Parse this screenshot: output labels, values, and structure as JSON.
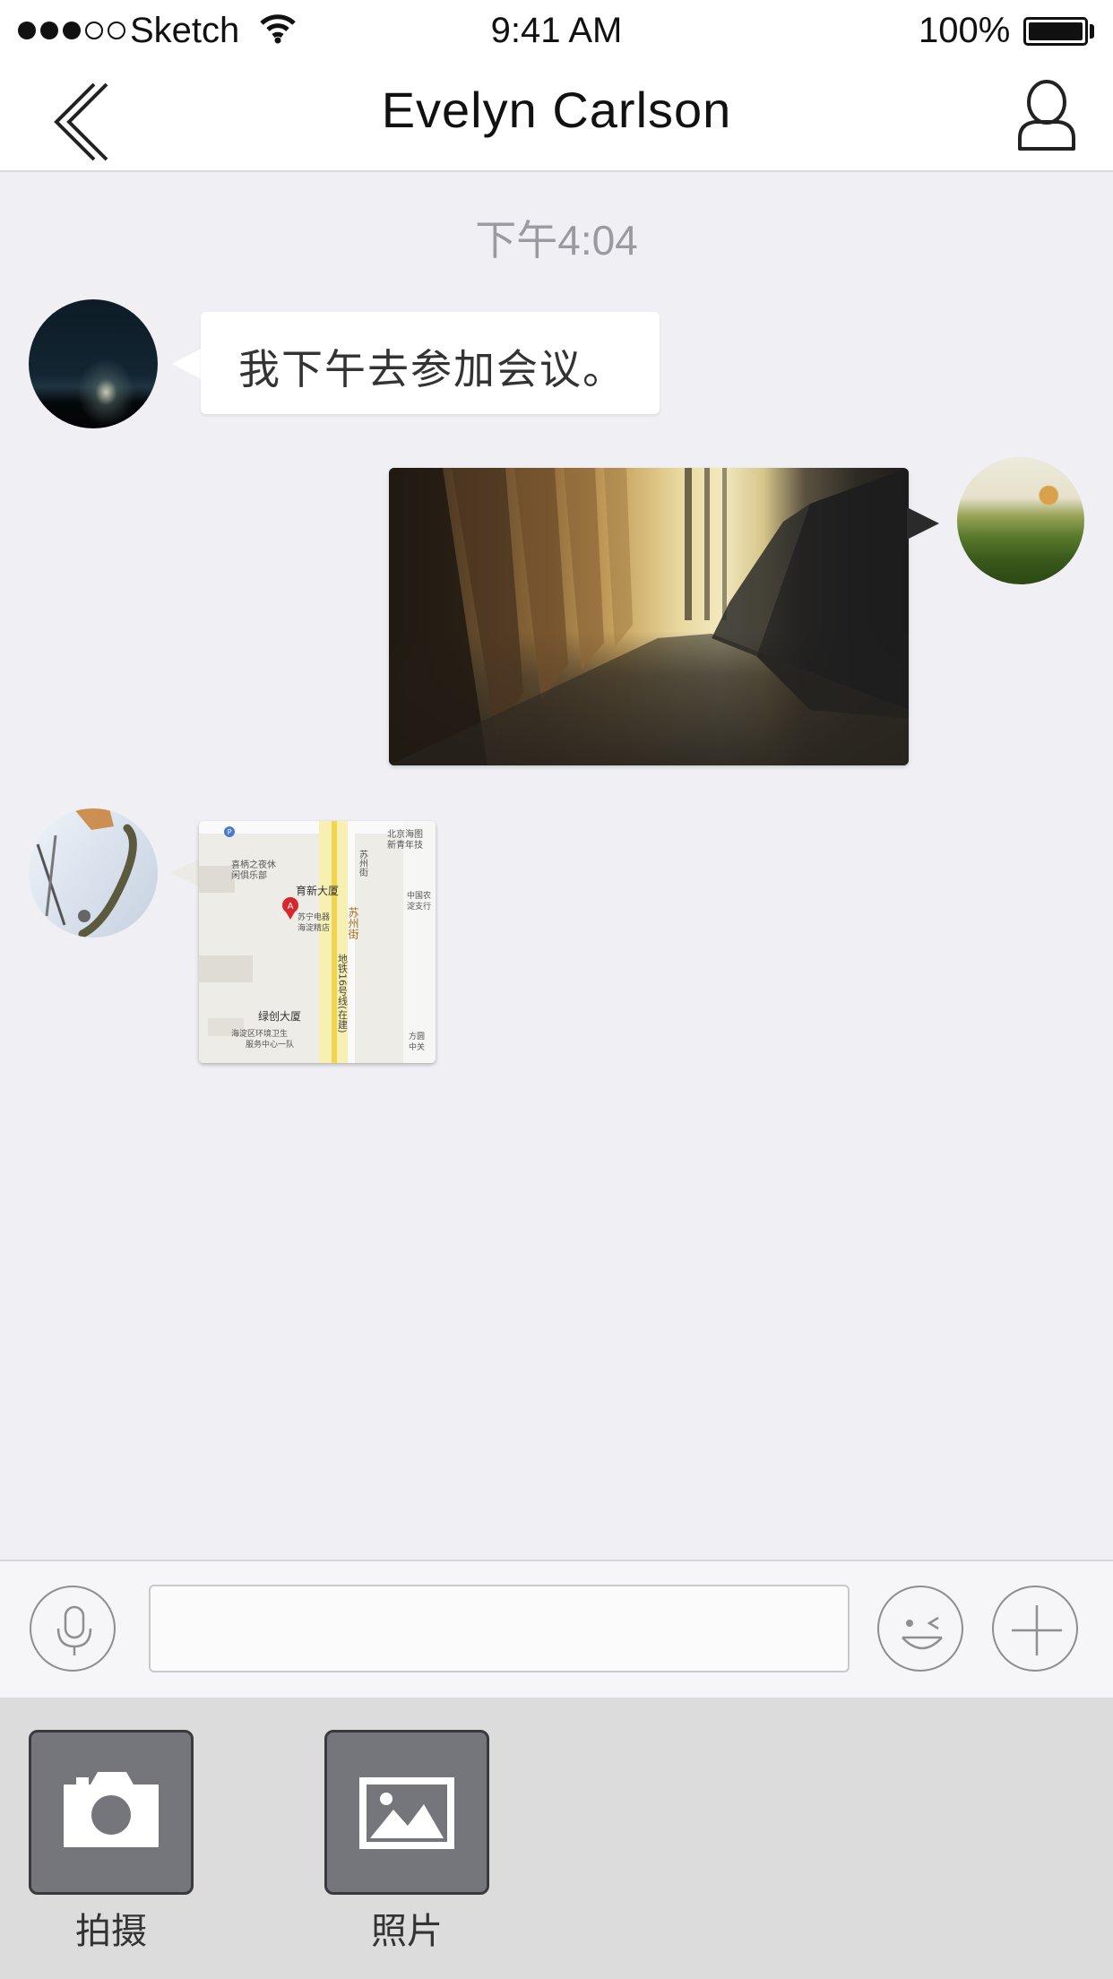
{
  "status_bar": {
    "carrier": "Sketch",
    "time": "9:41 AM",
    "battery_percent": "100%",
    "signal_bars_filled": 3,
    "signal_bars_total": 5
  },
  "nav": {
    "title": "Evelyn Carlson",
    "back_icon": "chevron-left-icon",
    "profile_icon": "user-icon"
  },
  "conversation": {
    "timestamp": "下午4:04",
    "messages": [
      {
        "sender": "incoming",
        "type": "text",
        "text": "我下午去参加会议。"
      },
      {
        "sender": "outgoing",
        "type": "image"
      },
      {
        "sender": "incoming",
        "type": "location"
      }
    ],
    "map_labels": {
      "poi_1": "北京海图",
      "poi_1b": "新青年技",
      "poi_2": "喜柄之夜休",
      "poi_2b": "闲俱乐部",
      "poi_3": "育新大厦",
      "poi_4": "苏宁电器",
      "poi_4b": "海淀精店",
      "poi_5": "中国农",
      "poi_5b": "淀支行",
      "poi_6": "绿创大厦",
      "poi_7": "海淀区环境卫生",
      "poi_7b": "服务中心一队",
      "poi_8": "方圆",
      "poi_8b": "中关",
      "street_1": "苏州街",
      "street_2": "地铁16号线(在建)",
      "street_3": "苏州街",
      "pin_label": "A"
    }
  },
  "input_bar": {
    "voice_icon": "microphone-icon",
    "emoji_icon": "emoji-icon",
    "plus_icon": "plus-icon",
    "text_value": ""
  },
  "attachments": [
    {
      "label": "拍摄",
      "icon": "camera-icon"
    },
    {
      "label": "照片",
      "icon": "photo-icon"
    }
  ]
}
